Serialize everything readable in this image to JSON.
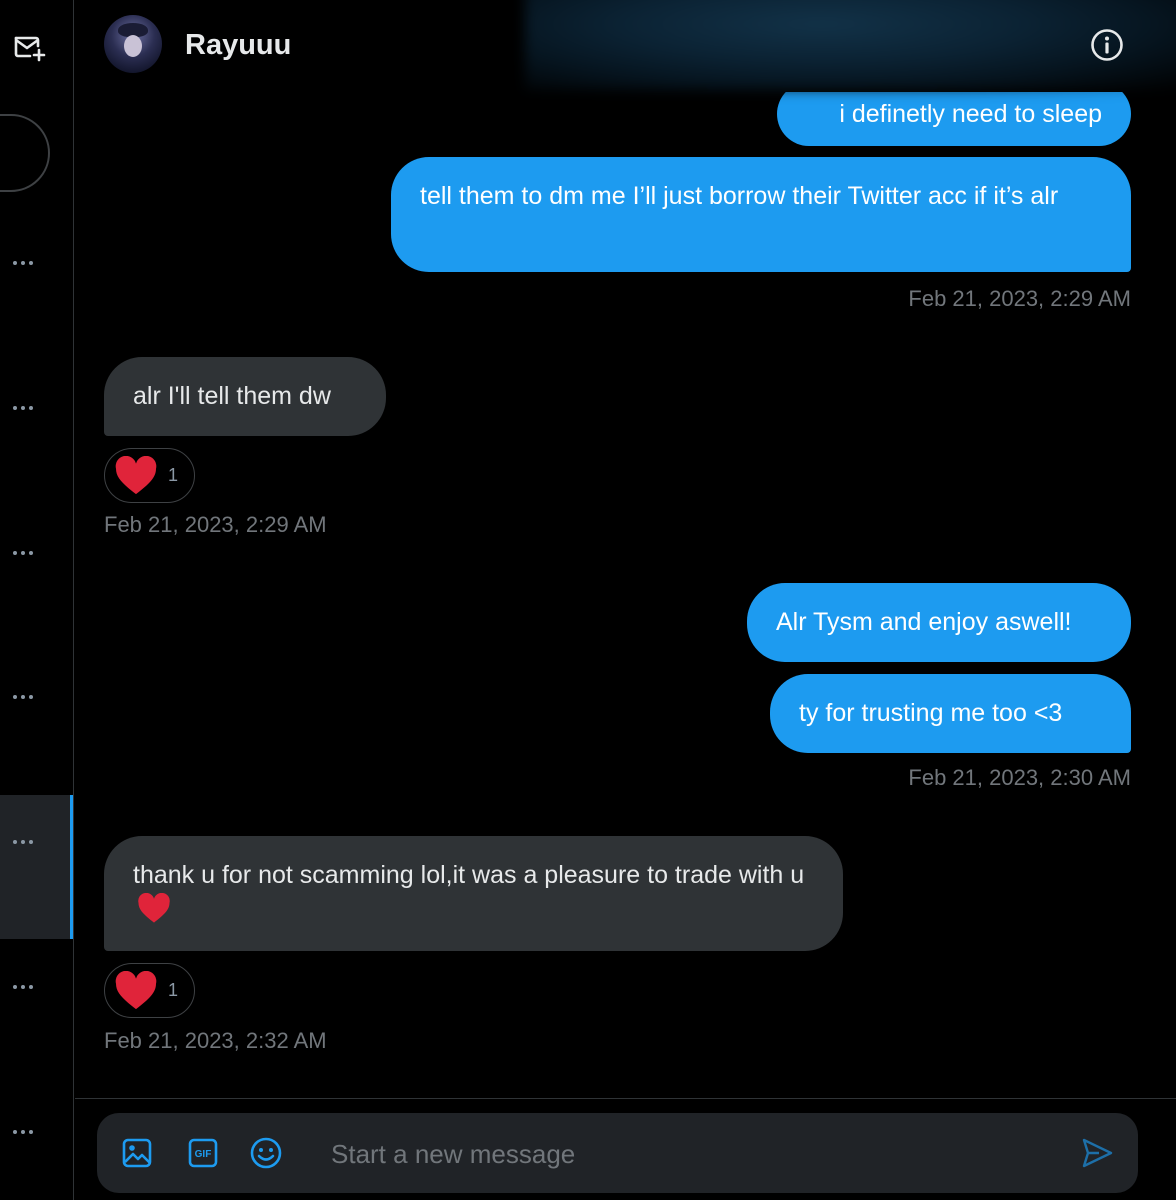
{
  "sidebar": {
    "compose_icon": "new-message-icon",
    "more_icon": "more-horizontal-icon"
  },
  "header": {
    "contact_name": "Rayuuu",
    "info_icon": "info-icon"
  },
  "messages": [
    {
      "side": "sent",
      "text": "i definetly need to sleep"
    },
    {
      "side": "sent",
      "text": "tell them to dm me I’ll just borrow their Twitter acc if it’s alr"
    },
    {
      "side": "sent",
      "timestamp": "Feb 21, 2023, 2:29 AM"
    },
    {
      "side": "received",
      "text": "alr I'll tell them dw",
      "reaction": {
        "emoji": "heart",
        "count": "1"
      }
    },
    {
      "side": "received",
      "timestamp": "Feb 21, 2023, 2:29 AM"
    },
    {
      "side": "sent",
      "text": "Alr Tysm and enjoy aswell!"
    },
    {
      "side": "sent",
      "text": "ty for trusting me too <3"
    },
    {
      "side": "sent",
      "timestamp": "Feb 21, 2023, 2:30 AM"
    },
    {
      "side": "received",
      "text": "thank u for not scamming lol,it was a pleasure to trade with u",
      "emoji": "heart",
      "reaction": {
        "emoji": "heart",
        "count": "1"
      }
    },
    {
      "side": "received",
      "timestamp": "Feb 21, 2023, 2:32 AM"
    }
  ],
  "composer": {
    "placeholder": "Start a new message",
    "icons": [
      "image-icon",
      "gif-icon",
      "emoji-icon",
      "send-icon"
    ]
  },
  "colors": {
    "background": "#000000",
    "sent_bubble": "#1d9bf0",
    "received_bubble": "#2f3336",
    "timestamp": "#71767b",
    "accent": "#1d9bf0",
    "heart": "#f91880"
  }
}
